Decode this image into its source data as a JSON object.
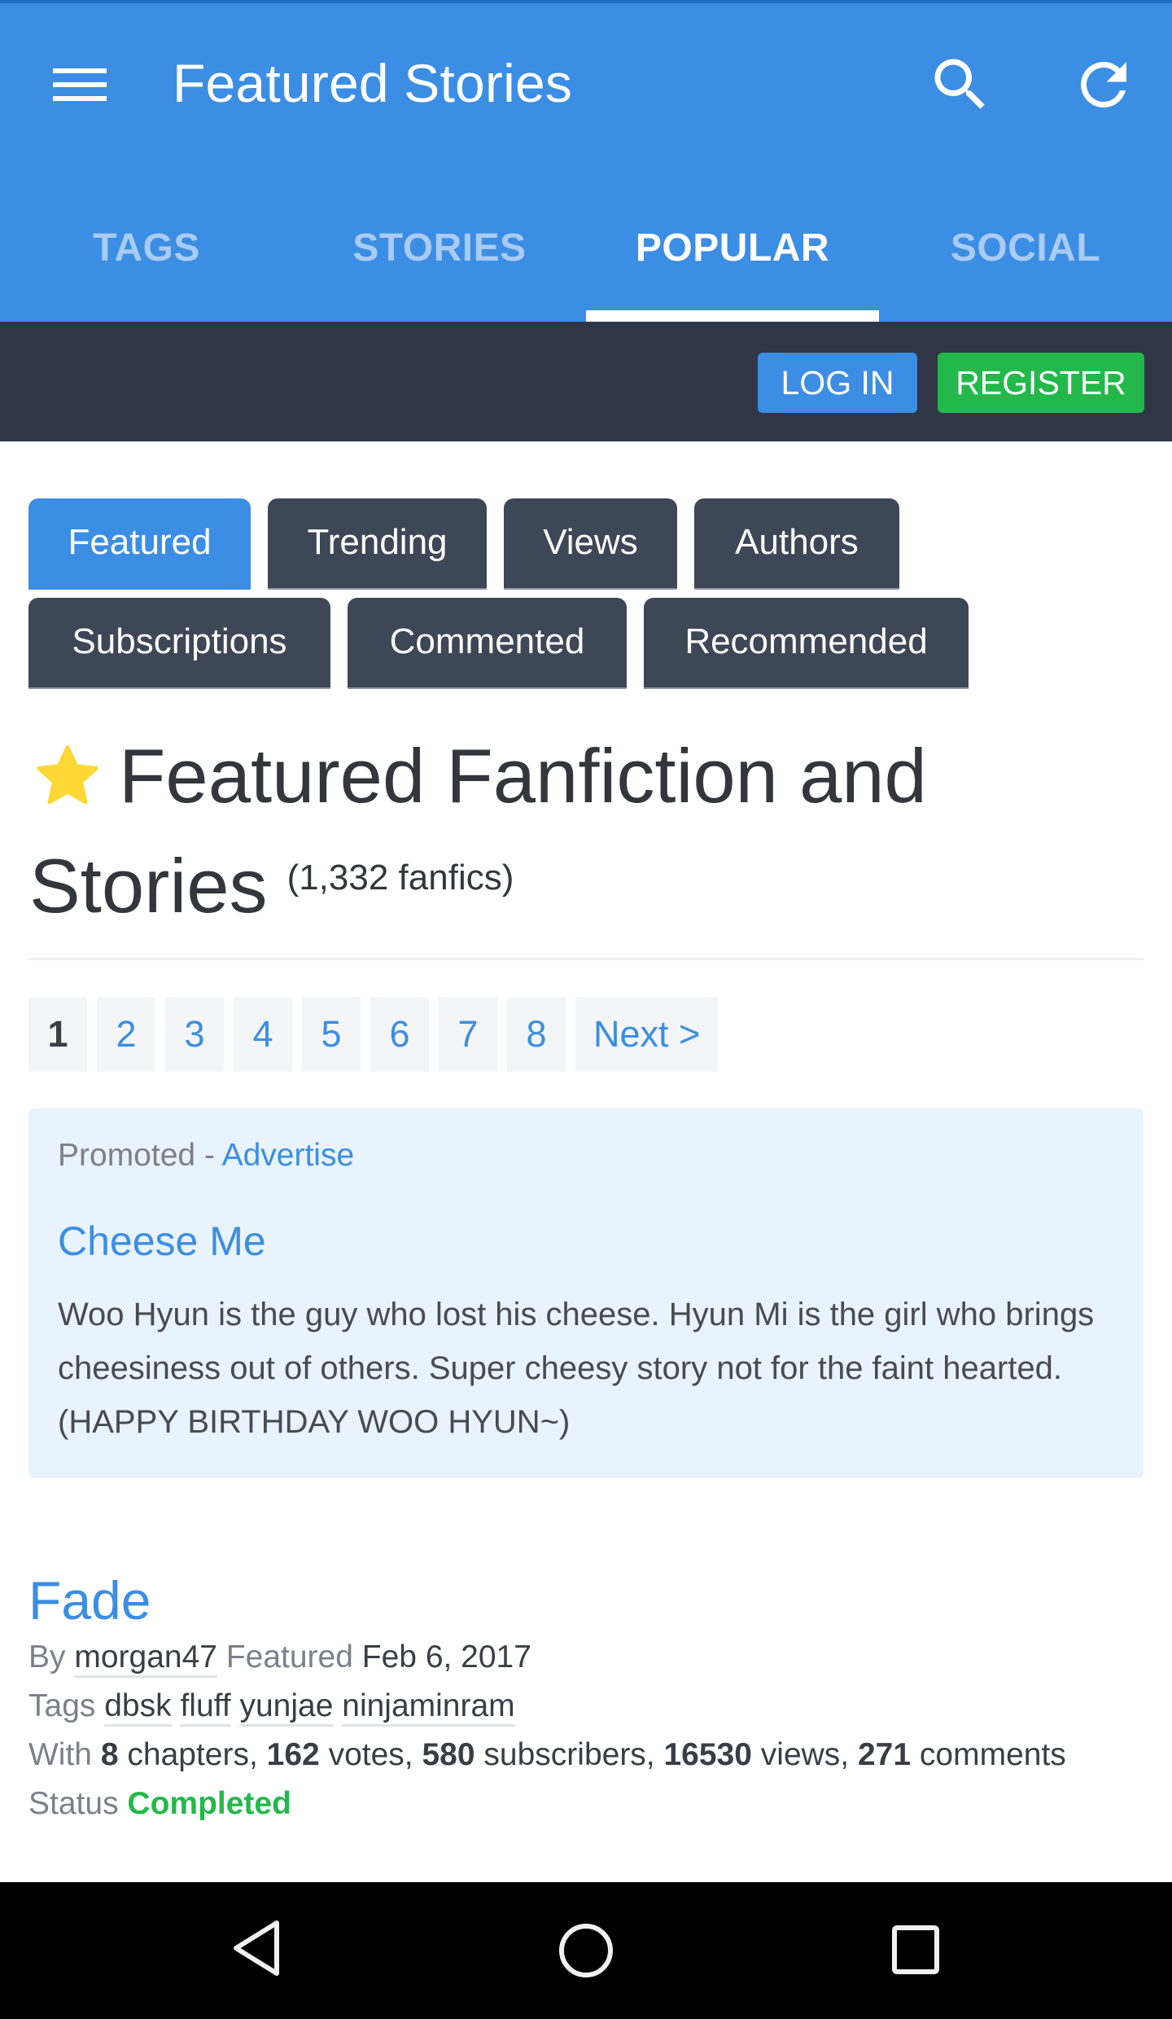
{
  "app": {
    "title": "Featured Stories",
    "icons": {
      "menu": "hamburger-icon",
      "search": "search-icon",
      "refresh": "refresh-icon"
    }
  },
  "tabs": [
    {
      "label": "TAGS",
      "active": false
    },
    {
      "label": "STORIES",
      "active": false
    },
    {
      "label": "POPULAR",
      "active": true
    },
    {
      "label": "SOCIAL",
      "active": false
    }
  ],
  "auth": {
    "login_label": "LOG IN",
    "register_label": "REGISTER"
  },
  "filters": {
    "row1": [
      "Featured",
      "Trending",
      "Views",
      "Authors"
    ],
    "row2": [
      "Subscriptions",
      "Commented",
      "Recommended"
    ],
    "active": "Featured"
  },
  "heading": {
    "line1": "Featured Fanfiction and",
    "line2": "Stories",
    "count": "(1,332 fanfics)",
    "icon": "star-icon"
  },
  "pagination": {
    "pages": [
      "1",
      "2",
      "3",
      "4",
      "5",
      "6",
      "7",
      "8"
    ],
    "current": "1",
    "next_label": "Next >"
  },
  "promo": {
    "label": "Promoted -",
    "advertise_link": "Advertise",
    "title": "Cheese Me",
    "body": "Woo Hyun is the guy who lost his cheese. Hyun Mi is the girl who brings cheesiness out of others. Super cheesy story not for the faint hearted. (HAPPY BIRTHDAY WOO HYUN~)"
  },
  "story": {
    "title": "Fade",
    "by_label": "By",
    "author": "morgan47",
    "featured_label": "Featured",
    "featured_date": "Feb 6, 2017",
    "tags_label": "Tags",
    "tags": [
      "dbsk",
      "fluff",
      "yunjae",
      "ninjaminram"
    ],
    "with_label": "With",
    "chapters": "8",
    "chapters_label": "chapters,",
    "votes": "162",
    "votes_label": "votes,",
    "subscribers": "580",
    "subscribers_label": "subscribers,",
    "views": "16530",
    "views_label": "views,",
    "comments": "271",
    "comments_label": "comments",
    "status_label": "Status",
    "status": "Completed"
  },
  "navbar": {
    "back": "back-icon",
    "home": "home-icon",
    "recents": "recents-icon"
  },
  "colors": {
    "primary": "#3b8ee3",
    "dark_bar": "#2f3747",
    "pill_dark": "#3d4756",
    "register_green": "#22b94a",
    "promo_bg": "#e9f3fc",
    "star": "#fdd835"
  }
}
